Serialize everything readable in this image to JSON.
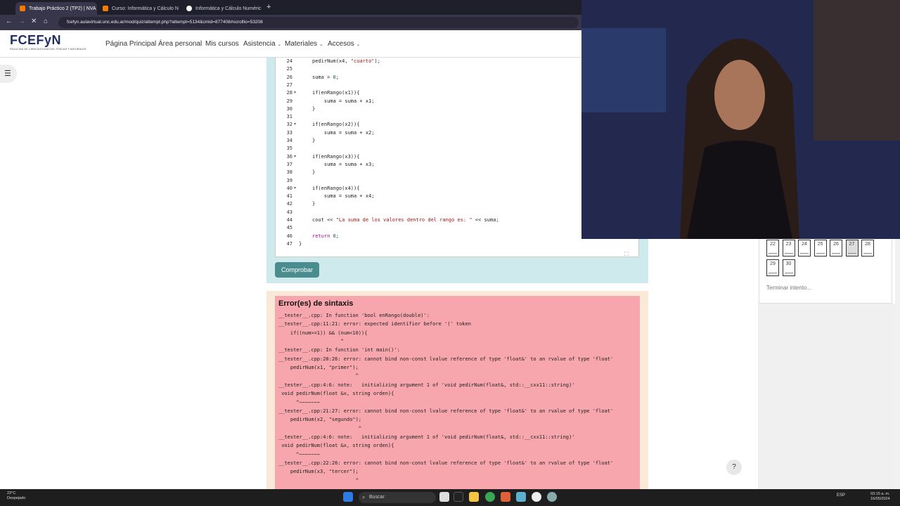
{
  "browser": {
    "tabs": [
      {
        "title": "Trabajo Práctico 2 (TP2) | NVA",
        "favicon_color": "#f57c00",
        "active": true
      },
      {
        "title": "Curso: Informática y Cálculo N",
        "favicon_color": "#f57c00",
        "active": false
      },
      {
        "title": "Informática y Cálculo Numéric",
        "favicon_color": "#ffffff",
        "active": false
      }
    ],
    "new_tab": "+",
    "url": "fcefyn.aulavirtual.unc.edu.ar/mod/quiz/attempt.php?attempt=5134&cmid=877408#scrollto=53208"
  },
  "site": {
    "logo": "FCEFyN",
    "logo_sub": "FACULTAD DE CIENCIAS EXACTAS, FÍSICAS Y NATURALES",
    "nav": [
      "Página Principal",
      "Área personal",
      "Mis cursos",
      "Asistencia",
      "Materiales",
      "Accesos"
    ],
    "sidebar_toggle": "☰"
  },
  "editor": {
    "lines": [
      {
        "n": "24",
        "fold": "",
        "code": "pedirNum(x4, \"cuarto\");"
      },
      {
        "n": "25",
        "fold": "",
        "code": ""
      },
      {
        "n": "26",
        "fold": "",
        "code": "suma = 0;"
      },
      {
        "n": "27",
        "fold": "",
        "code": ""
      },
      {
        "n": "28",
        "fold": "▾",
        "code": "if(enRango(x1)){"
      },
      {
        "n": "29",
        "fold": "",
        "code": "    suma = suma + x1;"
      },
      {
        "n": "30",
        "fold": "",
        "code": "}"
      },
      {
        "n": "31",
        "fold": "",
        "code": ""
      },
      {
        "n": "32",
        "fold": "▾",
        "code": "if(enRango(x2)){"
      },
      {
        "n": "33",
        "fold": "",
        "code": "    suma = suma + x2;"
      },
      {
        "n": "34",
        "fold": "",
        "code": "}"
      },
      {
        "n": "35",
        "fold": "",
        "code": ""
      },
      {
        "n": "36",
        "fold": "▾",
        "code": "if(enRango(x3)){"
      },
      {
        "n": "37",
        "fold": "",
        "code": "    suma = suma + x3;"
      },
      {
        "n": "38",
        "fold": "",
        "code": "}"
      },
      {
        "n": "39",
        "fold": "",
        "code": ""
      },
      {
        "n": "40",
        "fold": "▾",
        "code": "if(enRango(x4)){"
      },
      {
        "n": "41",
        "fold": "",
        "code": "    suma = suma + x4;"
      },
      {
        "n": "42",
        "fold": "",
        "code": "}"
      },
      {
        "n": "43",
        "fold": "",
        "code": ""
      },
      {
        "n": "44",
        "fold": "",
        "code": "cout << \"La suma de los valores dentro del rango es: \" << suma;"
      },
      {
        "n": "45",
        "fold": "",
        "code": ""
      },
      {
        "n": "46",
        "fold": "",
        "code": "return 0;"
      },
      {
        "n": "47",
        "fold": "",
        "code": "}"
      }
    ],
    "check_button": "Comprobar"
  },
  "errors": {
    "title": "Error(es) de sintaxis",
    "lines": [
      "__tester__.cpp: In function 'bool enRango(double)':",
      "__tester__.cpp:11:21: error: expected identifier before '(' token",
      "    if((num>=1)) && (num<10)){",
      "                     ^",
      "__tester__.cpp: In function 'int main()':",
      "__tester__.cpp:20:26: error: cannot bind non-const lvalue reference of type 'float&' to an rvalue of type 'float'",
      "    pedirNum(x1, \"primer\");",
      "                          ^",
      "__tester__.cpp:4:6: note:   initializing argument 1 of 'void pedirNum(float&, std::__cxx11::string)'",
      " void pedirNum(float &x, string orden){",
      "      ^~~~~~~~",
      "__tester__.cpp:21:27: error: cannot bind non-const lvalue reference of type 'float&' to an rvalue of type 'float'",
      "    pedirNum(x2, \"segundo\");",
      "                           ^",
      "__tester__.cpp:4:6: note:   initializing argument 1 of 'void pedirNum(float&, std::__cxx11::string)'",
      " void pedirNum(float &x, string orden){",
      "      ^~~~~~~~",
      "__tester__.cpp:22:26: error: cannot bind non-const lvalue reference of type 'float&' to an rvalue of type 'float'",
      "    pedirNum(x3, \"tercer\");",
      "                          ^"
    ]
  },
  "quiz_nav": {
    "questions": [
      "22",
      "23",
      "24",
      "25",
      "26",
      "27",
      "28",
      "29",
      "30"
    ],
    "current": "27",
    "finish": "Terminar intento..."
  },
  "help": "?",
  "taskbar": {
    "weather_temp": "23°C",
    "weather_desc": "Despejado",
    "search": "Buscar",
    "lang": "ESP",
    "time": "03:15 a. m.",
    "date": "16/05/2024"
  }
}
